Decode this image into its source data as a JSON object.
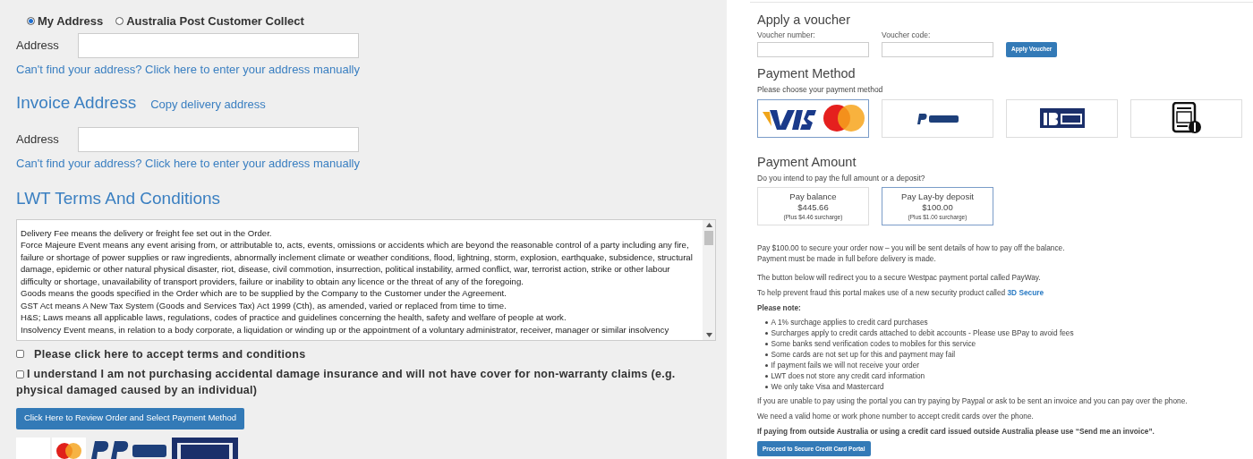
{
  "delivery": {
    "options": [
      {
        "label": "My Address",
        "selected": true
      },
      {
        "label": "Australia Post Customer Collect",
        "selected": false
      }
    ],
    "address_label": "Address",
    "manual_link": "Can't find your address? Click here to enter your address manually"
  },
  "invoice": {
    "heading": "Invoice Address",
    "copy_link": "Copy delivery address",
    "address_label": "Address",
    "manual_link": "Can't find your address? Click here to enter your address manually"
  },
  "terms": {
    "heading": "LWT Terms And Conditions",
    "lines": [
      "Delivery Fee means the delivery or freight fee set out in the Order.",
      "Force Majeure Event means any event arising from, or attributable to, acts, events, omissions or accidents which are beyond the reasonable control of a party including any fire, failure or shortage of power supplies or raw ingredients, abnormally inclement climate or weather conditions, flood, lightning, storm, explosion, earthquake, subsidence, structural damage, epidemic or other natural physical disaster, riot, disease, civil commotion, insurrection, political instability, armed conflict, war, terrorist action, strike or other labour difficulty or shortage, unavailability of transport providers, failure or inability to obtain any licence or the threat of any of the foregoing.",
      "Goods means the goods specified in the Order which are to be supplied by the Company to the Customer under the Agreement.",
      "GST Act means A New Tax System (Goods and Services Tax) Act 1999 (Cth), as amended, varied or replaced from time to time.",
      "H&S; Laws means all applicable laws, regulations, codes of practice and guidelines concerning the health, safety and welfare of people at work.",
      "Insolvency Event means, in relation to a body corporate, a liquidation or winding up or the appointment of a voluntary administrator, receiver, manager or similar insolvency"
    ]
  },
  "agreements": [
    {
      "label": "Please click here to accept terms and conditions",
      "checked": false
    },
    {
      "label": "I understand I am not purchasing accidental damage insurance and will not have cover for non-warranty claims (e.g. physical damaged caused by an individual)",
      "checked": false
    }
  ],
  "review_button": "Click Here to Review Order and Select Payment Method",
  "voucher": {
    "heading": "Apply a voucher",
    "fields": [
      "Voucher number:",
      "Voucher code:"
    ],
    "button": "Apply Voucher"
  },
  "payment_method": {
    "heading": "Payment Method",
    "prompt": "Please choose your payment method",
    "options": [
      {
        "kind": "card",
        "selected": true
      },
      {
        "kind": "paypal",
        "selected": false
      },
      {
        "kind": "bpay",
        "selected": false
      },
      {
        "kind": "invoice",
        "selected": false
      }
    ]
  },
  "payment_amount": {
    "heading": "Payment Amount",
    "prompt": "Do you intend to pay the full amount or a deposit?",
    "options": [
      {
        "title": "Pay balance",
        "amount": "$445.66",
        "surcharge": "(Plus $4.46 surcharge)",
        "selected": false
      },
      {
        "title": "Pay Lay-by deposit",
        "amount": "$100.00",
        "surcharge": "(Plus $1.00 surcharge)",
        "selected": true
      }
    ]
  },
  "info": {
    "deposit_lines": [
      "Pay $100.00 to secure your order now – you will be sent details of how to pay off the balance.",
      "Payment must be made in full before delivery is made."
    ],
    "redirect": "The button below will redirect you to a secure Westpac payment portal called PayWay.",
    "fraud": "To help prevent fraud this portal makes use of a new security product called",
    "fraud_link": "3D Secure",
    "note_heading": "Please note:",
    "notes": [
      "A 1% surchage applies to credit card purchases",
      "Surcharges apply to credit cards attached to debit accounts - Please use BPay to avoid fees",
      "Some banks send verification codes to mobiles for this service",
      "Some cards are not set up for this and payment may fail",
      "If payment fails we will not receive your order",
      "LWT does not store any credit card information",
      "We only take Visa and Mastercard"
    ],
    "unable": "If you are unable to pay using the portal you can try paying by Paypal or ask to be sent an invoice and you can pay over the phone.",
    "phone": "We need a valid home or work phone number to accept credit cards over the phone.",
    "overseas": "If paying from outside Australia or using a credit card issued outside Australia please use “Send me an invoice”."
  },
  "proceed_button": "Proceed to Secure Credit Card Portal"
}
